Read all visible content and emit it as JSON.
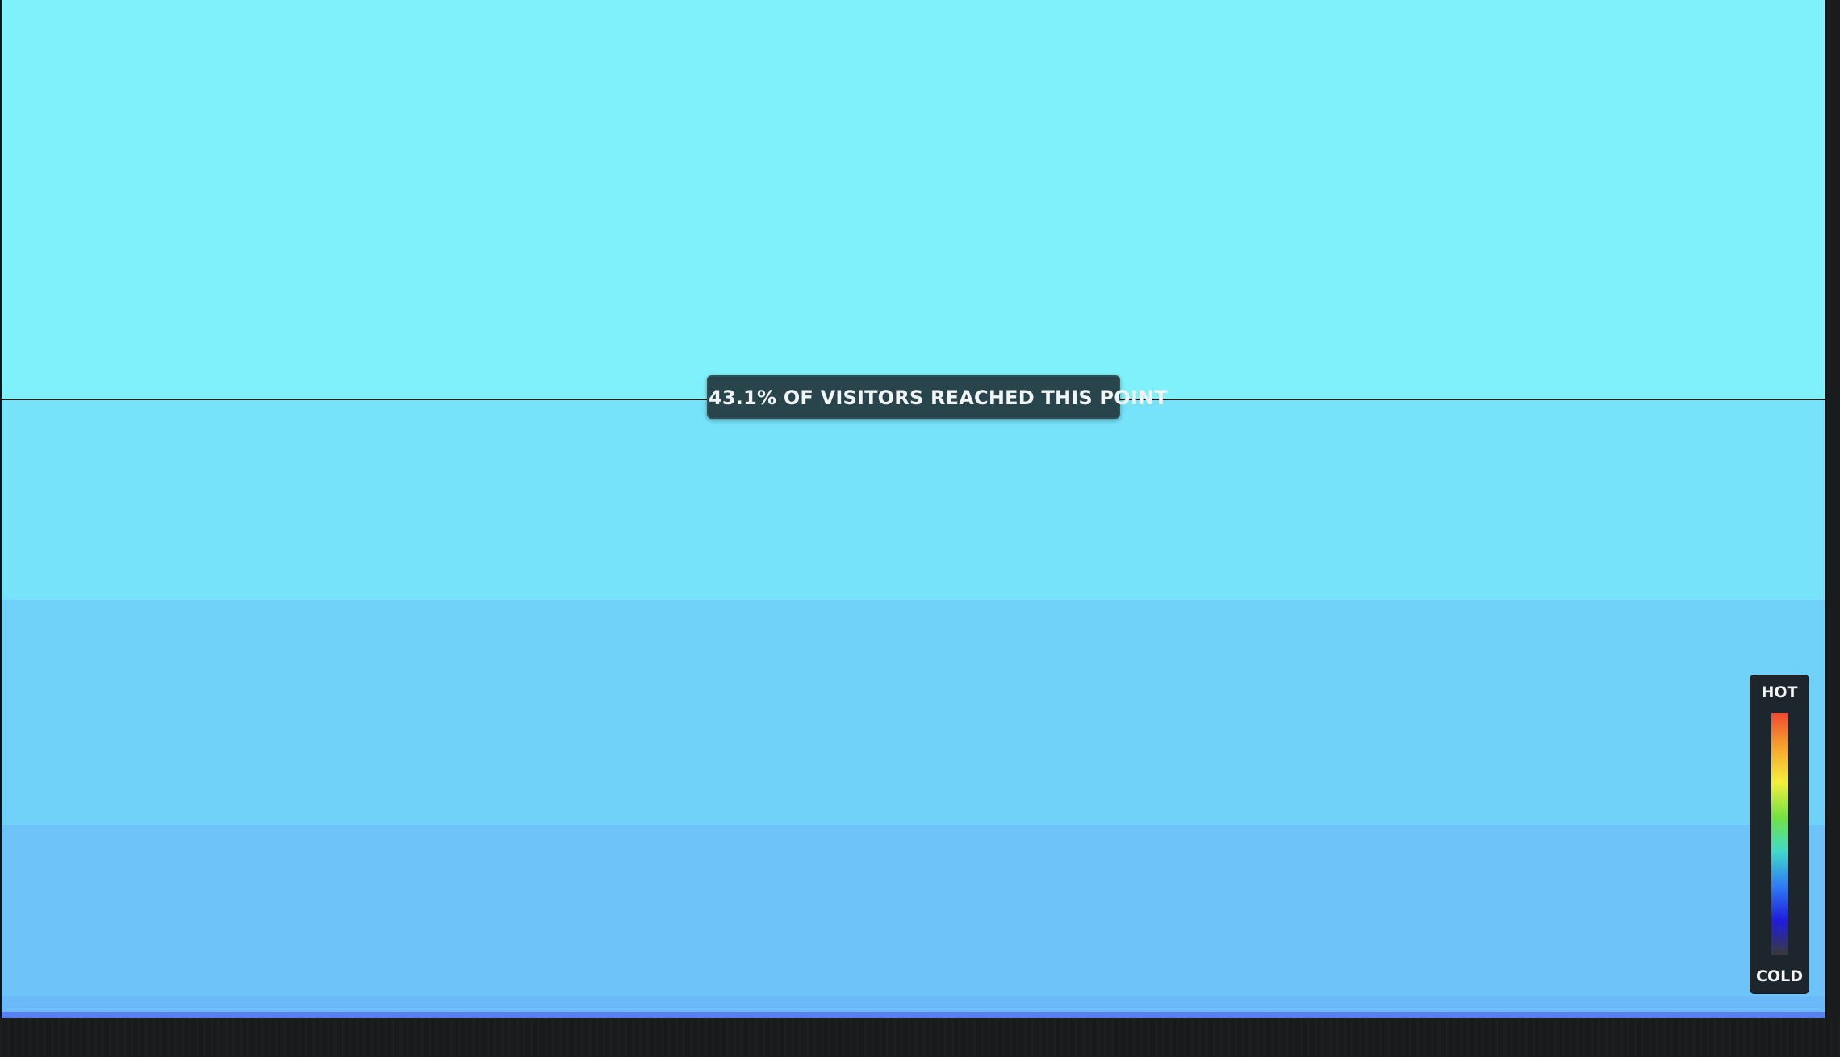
{
  "scroll_indicator": {
    "label": "43.1% OF VISITORS REACHED THIS POINT",
    "percent_reached": 43.1
  },
  "legend": {
    "hot_label": "HOT",
    "cold_label": "COLD",
    "gradient_colors": [
      "#f04a30",
      "#f7a52e",
      "#f4ee3c",
      "#73e243",
      "#3fd9c9",
      "#2f7cf4",
      "#1f1cdb",
      "#3a3a3a"
    ]
  },
  "colors": {
    "band_1": "#7ff1fb",
    "band_2": "#76e3fb",
    "band_3": "#71d2f9",
    "band_4": "#6ec4f8",
    "band_5": "#6bbaf7",
    "band_6": "#5a7ff0",
    "background": "#1a1b1c"
  }
}
